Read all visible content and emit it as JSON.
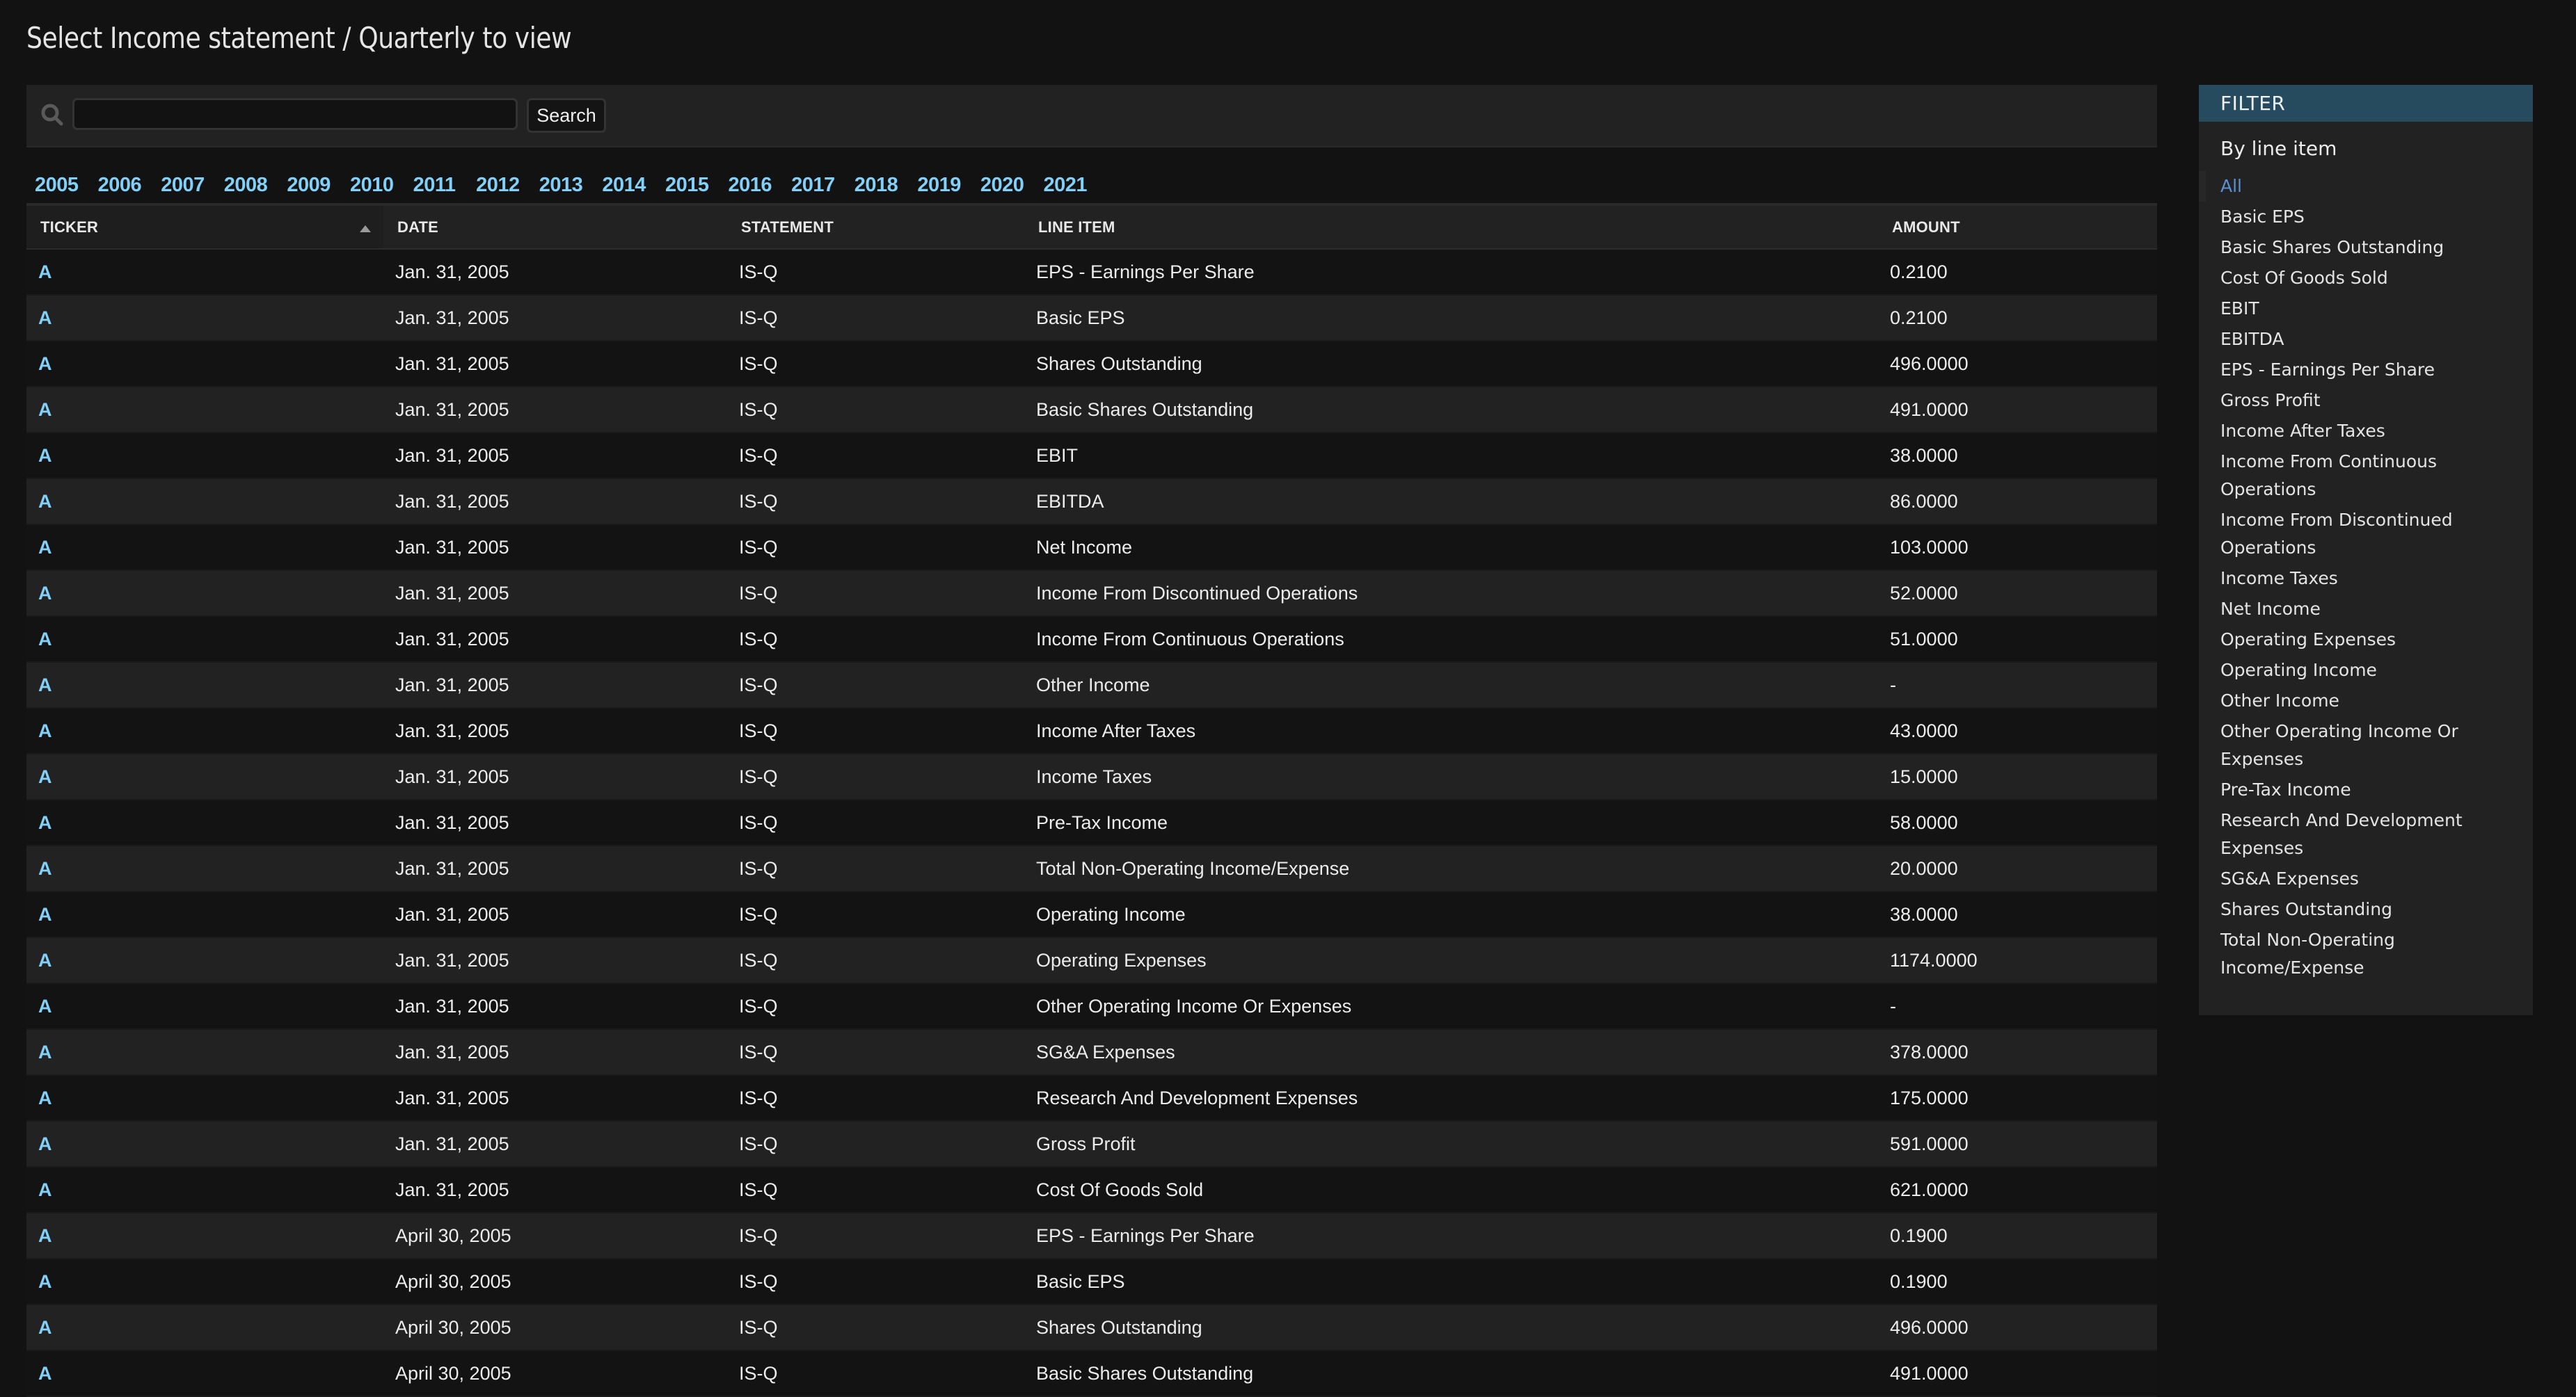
{
  "page": {
    "title": "Select Income statement / Quarterly to view"
  },
  "search": {
    "icon": "search-icon",
    "value": "",
    "placeholder": "",
    "button_label": "Search"
  },
  "years": [
    "2005",
    "2006",
    "2007",
    "2008",
    "2009",
    "2010",
    "2011",
    "2012",
    "2013",
    "2014",
    "2015",
    "2016",
    "2017",
    "2018",
    "2019",
    "2020",
    "2021"
  ],
  "table": {
    "columns": [
      "TICKER",
      "DATE",
      "STATEMENT",
      "LINE ITEM",
      "AMOUNT"
    ],
    "sorted_column": "TICKER",
    "sort_direction": "ascending",
    "rows": [
      {
        "ticker": "A",
        "date": "Jan. 31, 2005",
        "statement": "IS-Q",
        "line_item": "EPS - Earnings Per Share",
        "amount": "0.2100"
      },
      {
        "ticker": "A",
        "date": "Jan. 31, 2005",
        "statement": "IS-Q",
        "line_item": "Basic EPS",
        "amount": "0.2100"
      },
      {
        "ticker": "A",
        "date": "Jan. 31, 2005",
        "statement": "IS-Q",
        "line_item": "Shares Outstanding",
        "amount": "496.0000"
      },
      {
        "ticker": "A",
        "date": "Jan. 31, 2005",
        "statement": "IS-Q",
        "line_item": "Basic Shares Outstanding",
        "amount": "491.0000"
      },
      {
        "ticker": "A",
        "date": "Jan. 31, 2005",
        "statement": "IS-Q",
        "line_item": "EBIT",
        "amount": "38.0000"
      },
      {
        "ticker": "A",
        "date": "Jan. 31, 2005",
        "statement": "IS-Q",
        "line_item": "EBITDA",
        "amount": "86.0000"
      },
      {
        "ticker": "A",
        "date": "Jan. 31, 2005",
        "statement": "IS-Q",
        "line_item": "Net Income",
        "amount": "103.0000"
      },
      {
        "ticker": "A",
        "date": "Jan. 31, 2005",
        "statement": "IS-Q",
        "line_item": "Income From Discontinued Operations",
        "amount": "52.0000"
      },
      {
        "ticker": "A",
        "date": "Jan. 31, 2005",
        "statement": "IS-Q",
        "line_item": "Income From Continuous Operations",
        "amount": "51.0000"
      },
      {
        "ticker": "A",
        "date": "Jan. 31, 2005",
        "statement": "IS-Q",
        "line_item": "Other Income",
        "amount": "-"
      },
      {
        "ticker": "A",
        "date": "Jan. 31, 2005",
        "statement": "IS-Q",
        "line_item": "Income After Taxes",
        "amount": "43.0000"
      },
      {
        "ticker": "A",
        "date": "Jan. 31, 2005",
        "statement": "IS-Q",
        "line_item": "Income Taxes",
        "amount": "15.0000"
      },
      {
        "ticker": "A",
        "date": "Jan. 31, 2005",
        "statement": "IS-Q",
        "line_item": "Pre-Tax Income",
        "amount": "58.0000"
      },
      {
        "ticker": "A",
        "date": "Jan. 31, 2005",
        "statement": "IS-Q",
        "line_item": "Total Non-Operating Income/Expense",
        "amount": "20.0000"
      },
      {
        "ticker": "A",
        "date": "Jan. 31, 2005",
        "statement": "IS-Q",
        "line_item": "Operating Income",
        "amount": "38.0000"
      },
      {
        "ticker": "A",
        "date": "Jan. 31, 2005",
        "statement": "IS-Q",
        "line_item": "Operating Expenses",
        "amount": "1174.0000"
      },
      {
        "ticker": "A",
        "date": "Jan. 31, 2005",
        "statement": "IS-Q",
        "line_item": "Other Operating Income Or Expenses",
        "amount": "-"
      },
      {
        "ticker": "A",
        "date": "Jan. 31, 2005",
        "statement": "IS-Q",
        "line_item": "SG&A Expenses",
        "amount": "378.0000"
      },
      {
        "ticker": "A",
        "date": "Jan. 31, 2005",
        "statement": "IS-Q",
        "line_item": "Research And Development Expenses",
        "amount": "175.0000"
      },
      {
        "ticker": "A",
        "date": "Jan. 31, 2005",
        "statement": "IS-Q",
        "line_item": "Gross Profit",
        "amount": "591.0000"
      },
      {
        "ticker": "A",
        "date": "Jan. 31, 2005",
        "statement": "IS-Q",
        "line_item": "Cost Of Goods Sold",
        "amount": "621.0000"
      },
      {
        "ticker": "A",
        "date": "April 30, 2005",
        "statement": "IS-Q",
        "line_item": "EPS - Earnings Per Share",
        "amount": "0.1900"
      },
      {
        "ticker": "A",
        "date": "April 30, 2005",
        "statement": "IS-Q",
        "line_item": "Basic EPS",
        "amount": "0.1900"
      },
      {
        "ticker": "A",
        "date": "April 30, 2005",
        "statement": "IS-Q",
        "line_item": "Shares Outstanding",
        "amount": "496.0000"
      },
      {
        "ticker": "A",
        "date": "April 30, 2005",
        "statement": "IS-Q",
        "line_item": "Basic Shares Outstanding",
        "amount": "491.0000"
      }
    ]
  },
  "filter": {
    "title": "FILTER",
    "subtitle": "By line item",
    "selected": "All",
    "items": [
      "All",
      "Basic EPS",
      "Basic Shares Outstanding",
      "Cost Of Goods Sold",
      "EBIT",
      "EBITDA",
      "EPS - Earnings Per Share",
      "Gross Profit",
      "Income After Taxes",
      "Income From Continuous Operations",
      "Income From Discontinued Operations",
      "Income Taxes",
      "Net Income",
      "Operating Expenses",
      "Operating Income",
      "Other Income",
      "Other Operating Income Or Expenses",
      "Pre-Tax Income",
      "Research And Development Expenses",
      "SG&A Expenses",
      "Shares Outstanding",
      "Total Non-Operating Income/Expense"
    ]
  },
  "colors": {
    "background": "#121212",
    "panel": "#222222",
    "link": "#82cff7",
    "filter_header": "#264b5e",
    "filter_active": "#5d8fd3"
  }
}
